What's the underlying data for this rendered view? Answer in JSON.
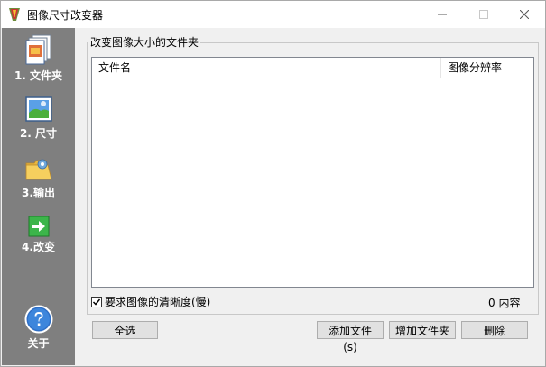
{
  "window": {
    "title": "图像尺寸改变器"
  },
  "sidebar": {
    "items": [
      {
        "label": "1. 文件夹",
        "icon": "folder-documents-icon"
      },
      {
        "label": "2. 尺寸",
        "icon": "picture-icon"
      },
      {
        "label": "3.输出",
        "icon": "folder-open-icon"
      },
      {
        "label": "4.改变",
        "icon": "green-arrow-icon"
      }
    ],
    "about": {
      "label": "关于",
      "icon": "help-icon"
    }
  },
  "main": {
    "group_title": "改变图像大小的文件夹",
    "columns": [
      "文件名",
      "图像分辨率"
    ],
    "rows": [],
    "quality_checkbox": {
      "label": "要求图像的清晰度(慢)",
      "checked": true
    },
    "count_text": "0 内容"
  },
  "buttons": {
    "select_all": "全选",
    "add_file": "添加文件(s)",
    "add_folder": "增加文件夹",
    "delete": "删除"
  }
}
